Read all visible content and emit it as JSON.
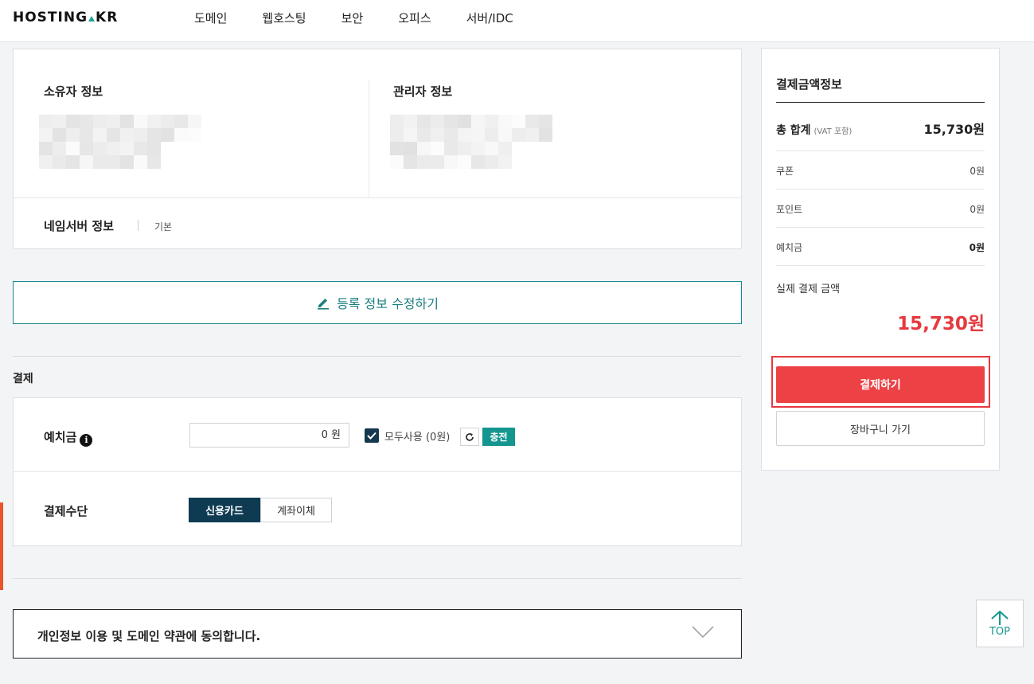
{
  "header": {
    "logo_left": "HOSTING",
    "logo_right": "KR",
    "nav": [
      "도메인",
      "웹호스팅",
      "보안",
      "오피스",
      "서버/IDC"
    ]
  },
  "registrant": {
    "owner_title": "소유자 정보",
    "admin_title": "관리자 정보",
    "nameserver_title": "네임서버 정보",
    "nameserver_value": "기본",
    "edit_button": "등록 정보 수정하기"
  },
  "payment": {
    "section_label": "결제",
    "deposit_label": "예치금",
    "deposit_value": "0 원",
    "use_all_label": "모두사용 (0원)",
    "charge_button": "충전",
    "method_label": "결제수단",
    "methods": [
      "신용카드",
      "계좌이체"
    ],
    "selected_method": "신용카드"
  },
  "agreement": {
    "text": "개인정보 이용 및 도메인 약관에 동의합니다."
  },
  "summary": {
    "title": "결제금액정보",
    "total_label": "총 합계",
    "total_note": "(VAT 포함)",
    "total_value": "15,730원",
    "coupon_label": "쿠폰",
    "coupon_value": "0원",
    "point_label": "포인트",
    "point_value": "0원",
    "deposit_label": "예치금",
    "deposit_value": "0원",
    "final_label": "실제 결제 금액",
    "final_value": "15,730원",
    "pay_button": "결제하기",
    "cart_button": "장바구니 가기"
  },
  "top_button": "TOP",
  "colors": {
    "accent_teal": "#14968f",
    "navy": "#0e3a52",
    "pay_red": "#ec4145"
  }
}
